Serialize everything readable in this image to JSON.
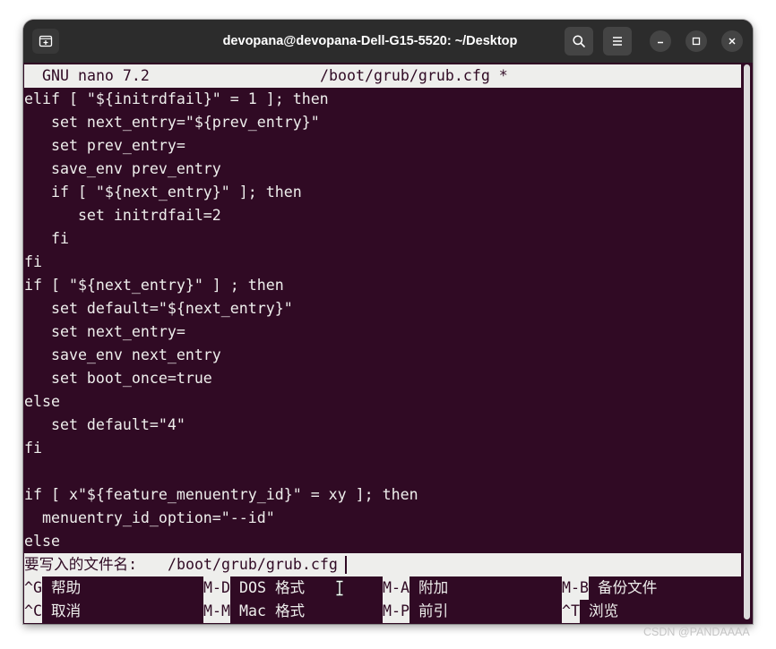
{
  "colors": {
    "page_bg": "#ffffff",
    "titlebar_bg": "#2c2c2c",
    "terminal_bg": "#300a24",
    "terminal_fg": "#eeeeec",
    "inverse_bg": "#eeeeec",
    "inverse_fg": "#300a24"
  },
  "window": {
    "title": "devopana@devopana-Dell-G15-5520: ~/Desktop",
    "icons": {
      "new_tab": "new-tab-icon",
      "search": "search-icon",
      "menu": "hamburger-menu-icon",
      "minimize": "minimize-icon",
      "maximize": "maximize-icon",
      "close": "close-icon",
      "mouse_pointer": "i-beam-pointer-icon"
    }
  },
  "nano": {
    "header": {
      "app": "GNU nano 7.2",
      "file": "/boot/grub/grub.cfg *"
    },
    "lines": [
      "elif [ \"${initrdfail}\" = 1 ]; then",
      "   set next_entry=\"${prev_entry}\"",
      "   set prev_entry=",
      "   save_env prev_entry",
      "   if [ \"${next_entry}\" ]; then",
      "      set initrdfail=2",
      "   fi",
      "fi",
      "if [ \"${next_entry}\" ] ; then",
      "   set default=\"${next_entry}\"",
      "   set next_entry=",
      "   save_env next_entry",
      "   set boot_once=true",
      "else",
      "   set default=\"4\"",
      "fi",
      "",
      "if [ x\"${feature_menuentry_id}\" = xy ]; then",
      "  menuentry_id_option=\"--id\"",
      "else"
    ],
    "prompt": {
      "label": "要写入的文件名:",
      "value": "/boot/grub/grub.cfg"
    },
    "shortcuts": [
      [
        {
          "key": "^G",
          "label": "帮助"
        },
        {
          "key": "M-D",
          "label": "DOS 格式"
        },
        {
          "key": "M-A",
          "label": "附加"
        },
        {
          "key": "M-B",
          "label": "备份文件"
        }
      ],
      [
        {
          "key": "^C",
          "label": "取消"
        },
        {
          "key": "M-M",
          "label": "Mac 格式"
        },
        {
          "key": "M-P",
          "label": "前引"
        },
        {
          "key": "^T",
          "label": "浏览"
        }
      ]
    ]
  },
  "watermark": "CSDN @PANDAAAA"
}
